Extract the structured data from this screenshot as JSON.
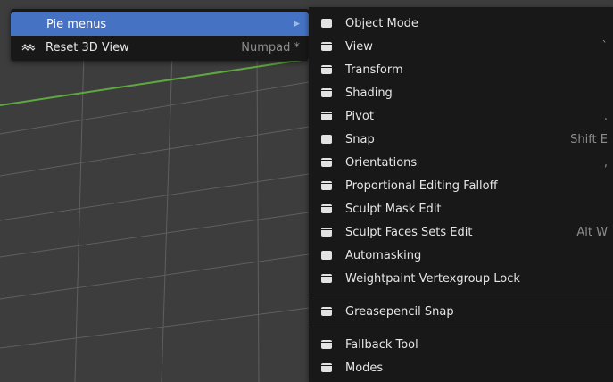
{
  "main_menu": {
    "items": [
      {
        "label": "Pie menus",
        "shortcut": "",
        "icon": "",
        "submenu": true
      },
      {
        "label": "Reset 3D View",
        "shortcut": "Numpad *",
        "icon": "view-icon",
        "submenu": false
      }
    ],
    "active_bg": "#4672c4"
  },
  "pie_submenu": {
    "group1": [
      {
        "label": "Object Mode",
        "shortcut": ""
      },
      {
        "label": "View",
        "shortcut": "`"
      },
      {
        "label": "Transform",
        "shortcut": ""
      },
      {
        "label": "Shading",
        "shortcut": ""
      },
      {
        "label": "Pivot",
        "shortcut": "."
      },
      {
        "label": "Snap",
        "shortcut": "Shift E"
      },
      {
        "label": "Orientations",
        "shortcut": ","
      },
      {
        "label": "Proportional Editing Falloff",
        "shortcut": ""
      },
      {
        "label": "Sculpt Mask Edit",
        "shortcut": ""
      },
      {
        "label": "Sculpt Faces Sets Edit",
        "shortcut": "Alt W"
      },
      {
        "label": "Automasking",
        "shortcut": ""
      },
      {
        "label": "Weightpaint Vertexgroup Lock",
        "shortcut": ""
      }
    ],
    "group2": [
      {
        "label": "Greasepencil Snap",
        "shortcut": ""
      }
    ],
    "group3": [
      {
        "label": "Fallback Tool",
        "shortcut": ""
      },
      {
        "label": "Modes",
        "shortcut": ""
      }
    ],
    "icon": "menu-entry-icon"
  },
  "colors": {
    "menu_bg": "#181818",
    "viewport_bg": "#3d3d3d",
    "grid_line": "#5a5a5a",
    "x_axis": "#57a33b"
  }
}
